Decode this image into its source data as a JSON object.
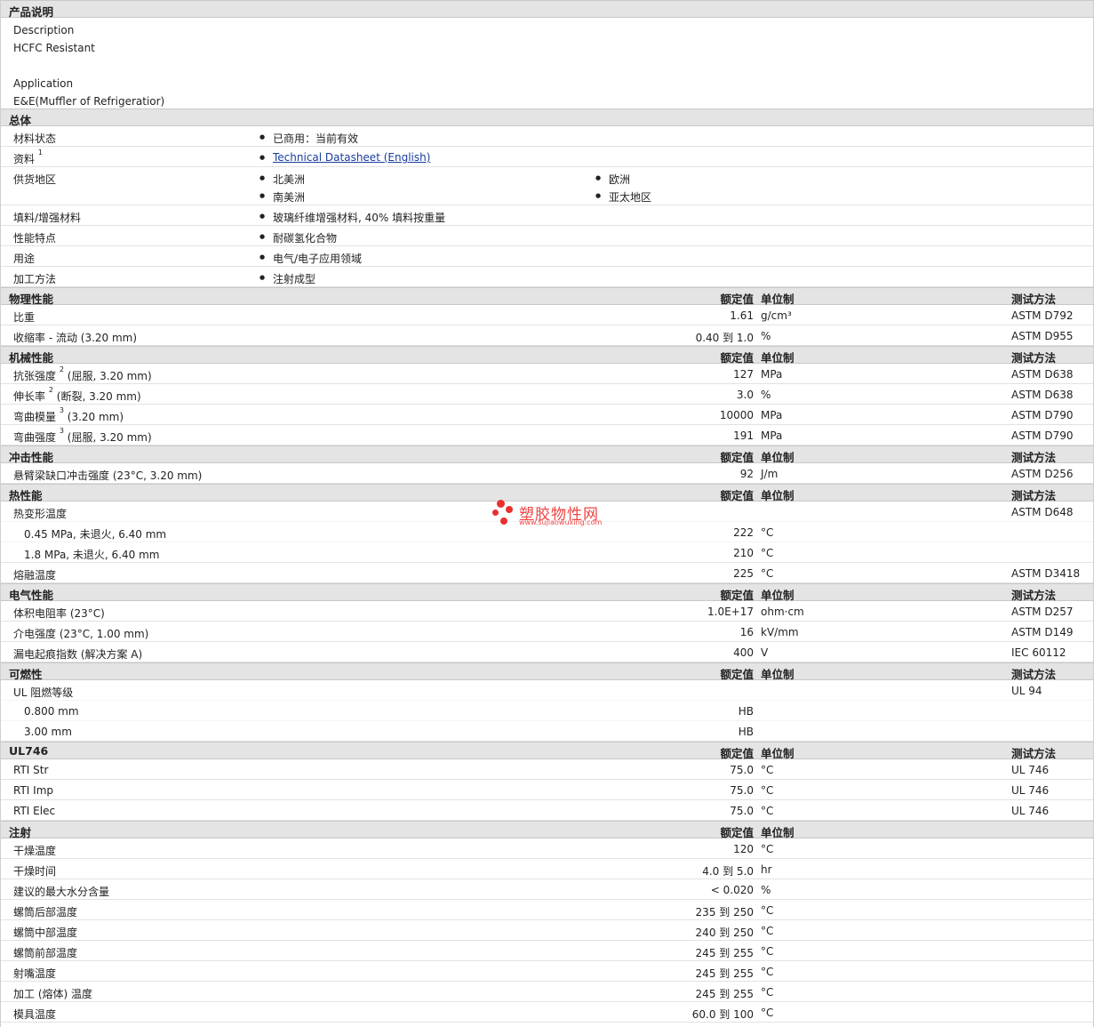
{
  "sections": {
    "description": "产品说明",
    "general": "总体",
    "physical": "物理性能",
    "mechanical": "机械性能",
    "impact": "冲击性能",
    "thermal": "热性能",
    "electrical": "电气性能",
    "flammability": "可燃性",
    "ul746": "UL746",
    "injection": "注射"
  },
  "headers": {
    "value": "额定值",
    "unit": "单位制",
    "method": "测试方法"
  },
  "description": {
    "description_label": "Description",
    "description_text": "HCFC Resistant",
    "application_label": "Application",
    "application_text": "E&E(Muffler of Refrigeratior)"
  },
  "general": {
    "material_status_label": "材料状态",
    "material_status": "已商用：当前有效",
    "documents_label": "资料",
    "documents_sup": "1",
    "documents_link": "Technical Datasheet (English)",
    "availability_label": "供货地区",
    "regions": [
      "北美洲",
      "欧洲",
      "南美洲",
      "亚太地区"
    ],
    "filler_label": "填料/增强材料",
    "filler": "玻璃纤维增强材料, 40% 填料按重量",
    "features_label": "性能特点",
    "features": "耐碳氢化合物",
    "uses_label": "用途",
    "uses": "电气/电子应用领域",
    "processing_label": "加工方法",
    "processing": "注射成型"
  },
  "physical": [
    {
      "label": "比重",
      "value": "1.61",
      "unit": "g/cm³",
      "method": "ASTM D792"
    },
    {
      "label": "收缩率 - 流动 (3.20 mm)",
      "value": "0.40 到 1.0",
      "unit": "%",
      "method": "ASTM D955"
    }
  ],
  "mechanical": [
    {
      "label": "抗张强度",
      "sup": "2",
      "cond": "(屈服, 3.20 mm)",
      "value": "127",
      "unit": "MPa",
      "method": "ASTM D638"
    },
    {
      "label": "伸长率",
      "sup": "2",
      "cond": "(断裂, 3.20 mm)",
      "value": "3.0",
      "unit": "%",
      "method": "ASTM D638"
    },
    {
      "label": "弯曲模量",
      "sup": "3",
      "cond": "(3.20 mm)",
      "value": "10000",
      "unit": "MPa",
      "method": "ASTM D790"
    },
    {
      "label": "弯曲强度",
      "sup": "3",
      "cond": "(屈服, 3.20 mm)",
      "value": "191",
      "unit": "MPa",
      "method": "ASTM D790"
    }
  ],
  "impact": [
    {
      "label": "悬臂梁缺口冲击强度 (23°C, 3.20 mm)",
      "value": "92",
      "unit": "J/m",
      "method": "ASTM D256"
    }
  ],
  "thermal": {
    "hdt_label": "热变形温度",
    "hdt_method": "ASTM D648",
    "hdt_rows": [
      {
        "label": "0.45 MPa, 未退火, 6.40 mm",
        "value": "222",
        "unit": "°C"
      },
      {
        "label": "1.8 MPa, 未退火, 6.40 mm",
        "value": "210",
        "unit": "°C"
      }
    ],
    "melt_label": "熔融温度",
    "melt_value": "225",
    "melt_unit": "°C",
    "melt_method": "ASTM D3418"
  },
  "electrical": [
    {
      "label": "体积电阻率 (23°C)",
      "value": "1.0E+17",
      "unit": "ohm·cm",
      "method": "ASTM D257"
    },
    {
      "label": "介电强度 (23°C, 1.00 mm)",
      "value": "16",
      "unit": "kV/mm",
      "method": "ASTM D149"
    },
    {
      "label": "漏电起痕指数 (解决方案 A)",
      "value": "400",
      "unit": "V",
      "method": "IEC 60112"
    }
  ],
  "flammability": {
    "ul_label": "UL 阻燃等级",
    "ul_method": "UL 94",
    "rows": [
      {
        "label": "0.800 mm",
        "value": "HB"
      },
      {
        "label": "3.00 mm",
        "value": "HB"
      }
    ]
  },
  "ul746": [
    {
      "label": "RTI Str",
      "value": "75.0",
      "unit": "°C",
      "method": "UL 746"
    },
    {
      "label": "RTI Imp",
      "value": "75.0",
      "unit": "°C",
      "method": "UL 746"
    },
    {
      "label": "RTI Elec",
      "value": "75.0",
      "unit": "°C",
      "method": "UL 746"
    }
  ],
  "injection": [
    {
      "label": "干燥温度",
      "value": "120",
      "unit": "°C"
    },
    {
      "label": "干燥时间",
      "value": "4.0 到 5.0",
      "unit": "hr"
    },
    {
      "label": "建议的最大水分含量",
      "value": "< 0.020",
      "unit": "%"
    },
    {
      "label": "螺筒后部温度",
      "value": "235 到 250",
      "unit": "°C"
    },
    {
      "label": "螺筒中部温度",
      "value": "240 到 250",
      "unit": "°C"
    },
    {
      "label": "螺筒前部温度",
      "value": "245 到 255",
      "unit": "°C"
    },
    {
      "label": "射嘴温度",
      "value": "245 到 255",
      "unit": "°C"
    },
    {
      "label": "加工 (熔体) 温度",
      "value": "245 到 255",
      "unit": "°C"
    },
    {
      "label": "模具温度",
      "value": "60.0 到 100",
      "unit": "°C"
    }
  ],
  "watermark": {
    "text": "塑胶物性网",
    "url": "www.sujiaowuxing.com"
  }
}
